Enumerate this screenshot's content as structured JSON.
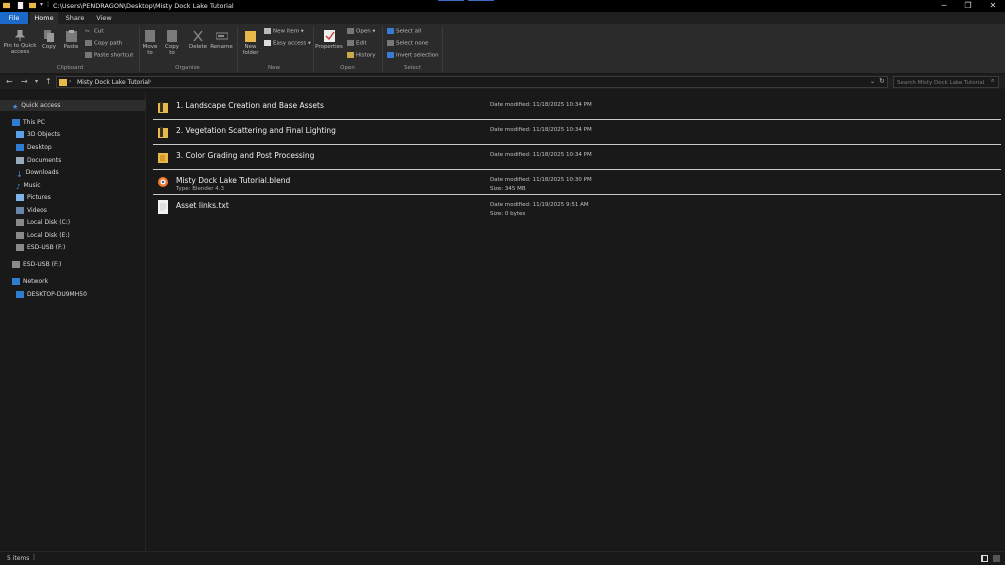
{
  "titlebar": {
    "path": "C:\\Users\\PENDRAGON\\Desktop\\Misty Dock Lake Tutorial",
    "minimize": "─",
    "maximize": "❐",
    "close": "✕"
  },
  "tabs": {
    "file": "File",
    "home": "Home",
    "share": "Share",
    "view": "View"
  },
  "ribbon": {
    "clipboard": {
      "pin": "Pin to Quick access",
      "copy": "Copy",
      "paste": "Paste",
      "cut": "Cut",
      "copy_path": "Copy path",
      "paste_shortcut": "Paste shortcut",
      "label": "Clipboard"
    },
    "organize": {
      "move_to": "Move to",
      "copy_to": "Copy to",
      "delete": "Delete",
      "rename": "Rename",
      "label": "Organize"
    },
    "new": {
      "new_folder": "New folder",
      "new_item": "New item",
      "easy_access": "Easy access",
      "label": "New"
    },
    "open": {
      "properties": "Properties",
      "open": "Open",
      "edit": "Edit",
      "history": "History",
      "label": "Open"
    },
    "select": {
      "select_all": "Select all",
      "select_none": "Select none",
      "invert_selection": "Invert selection",
      "label": "Select"
    }
  },
  "address": {
    "crumb": "Misty Dock Lake Tutorial",
    "search_placeholder": "Search Misty Dock Lake Tutorial"
  },
  "nav": {
    "quick_access": "Quick access",
    "this_pc": "This PC",
    "items": [
      "3D Objects",
      "Desktop",
      "Documents",
      "Downloads",
      "Music",
      "Pictures",
      "Videos",
      "Local Disk (C:)",
      "Local Disk (E:)",
      "ESD-USB (F:)"
    ],
    "esd_usb": "ESD-USB (F:)",
    "network": "Network",
    "network_pc": "DESKTOP-DU9MH50"
  },
  "files": [
    {
      "name": "1. Landscape Creation and Base Assets",
      "type": "",
      "date": "Date modified: 11/18/2025 10:34 PM",
      "size": "",
      "icon": "folder-icon"
    },
    {
      "name": "2. Vegetation Scattering and Final Lighting",
      "type": "",
      "date": "Date modified: 11/18/2025 10:34 PM",
      "size": "",
      "icon": "folder-icon"
    },
    {
      "name": "3. Color Grading and Post Processing",
      "type": "",
      "date": "Date modified: 11/18/2025 10:34 PM",
      "size": "",
      "icon": "folder-icon"
    },
    {
      "name": "Misty Dock Lake Tutorial.blend",
      "type": "Type: Blender 4.3",
      "date": "Date modified: 11/18/2025 10:30 PM",
      "size": "Size: 345 MB",
      "icon": "blender-file-icon"
    },
    {
      "name": "Asset links.txt",
      "type": "",
      "date": "Date modified: 11/19/2025 9:51 AM",
      "size": "Size: 0 bytes",
      "icon": "text-file-icon"
    }
  ],
  "status": {
    "count": "5 items"
  },
  "colors": {
    "accent": "#1b6ac9",
    "folder": "#e8b84a",
    "background": "#191919"
  }
}
